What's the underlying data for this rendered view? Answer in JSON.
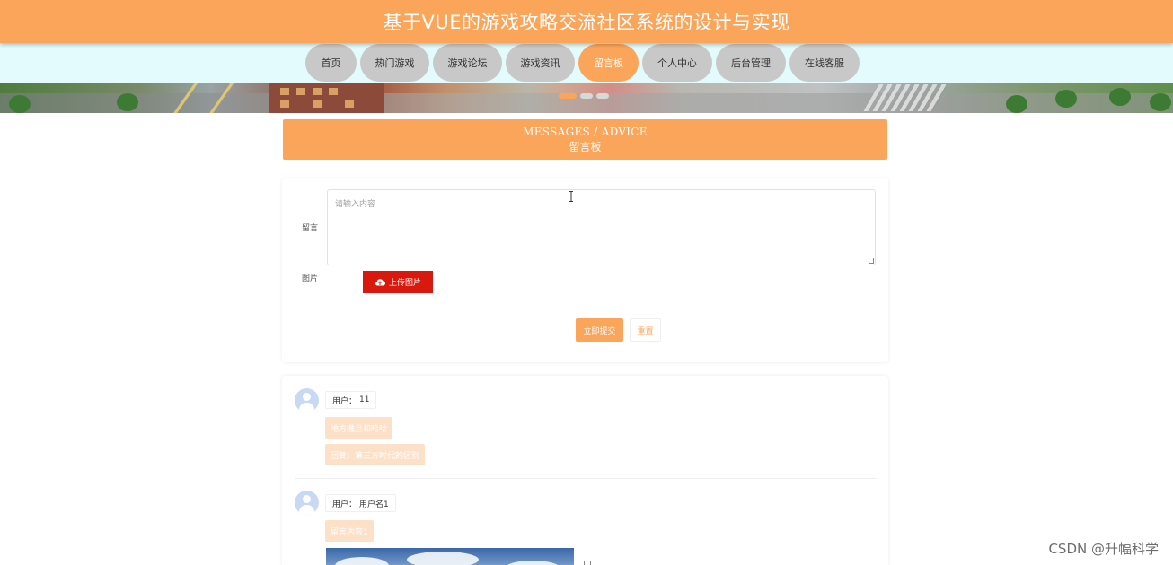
{
  "header": {
    "title": "基于VUE的游戏攻略交流社区系统的设计与实现"
  },
  "nav": {
    "items": [
      {
        "label": "首页",
        "active": false
      },
      {
        "label": "热门游戏",
        "active": false
      },
      {
        "label": "游戏论坛",
        "active": false
      },
      {
        "label": "游戏资讯",
        "active": false
      },
      {
        "label": "留言板",
        "active": true
      },
      {
        "label": "个人中心",
        "active": false
      },
      {
        "label": "后台管理",
        "active": false
      },
      {
        "label": "在线客服",
        "active": false
      }
    ]
  },
  "banner": {
    "slide_count": 3,
    "active_slide": 1
  },
  "section": {
    "title_en": "MESSAGES / ADVICE",
    "title_cn": "留言板"
  },
  "form": {
    "message_label": "留言",
    "message_placeholder": "请输入内容",
    "image_label": "图片",
    "upload_label": "上传图片",
    "submit_label": "立即提交",
    "reset_label": "重置"
  },
  "comments": [
    {
      "user_prefix": "用户：",
      "user": "11",
      "content": "地方撒旦和哈哈",
      "reply": "回复：第三方时代的区别"
    },
    {
      "user_prefix": "用户：",
      "user": "用户名1",
      "content": "留言内容1"
    }
  ],
  "watermark": "CSDN @升幅科学",
  "colors": {
    "accent": "#fba55b",
    "upload": "#d9180e",
    "nav_bg": "#e3fbfd",
    "nav_item": "#c8c8c8"
  }
}
